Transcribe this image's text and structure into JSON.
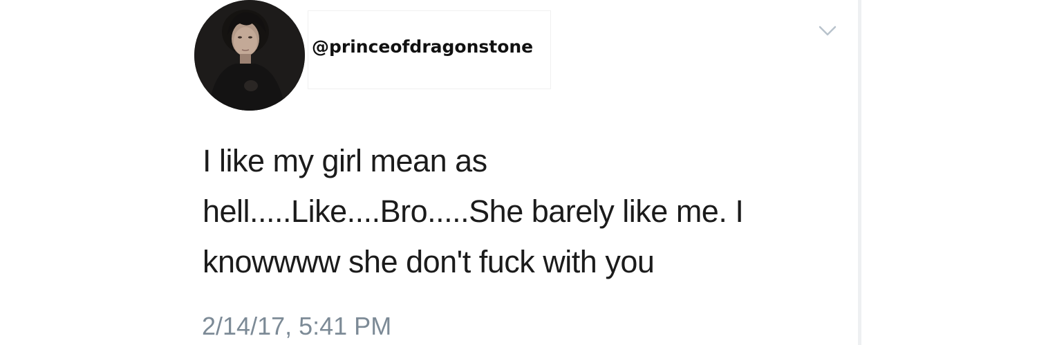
{
  "tweet": {
    "handle": "@princeofdragonstone",
    "text_lines": [
      "I like my girl mean as",
      "hell.....Like....Bro.....She barely like me. I",
      "knowwww she don't fuck with you"
    ],
    "timestamp": "2/14/17, 5:41 PM"
  },
  "icons": {
    "menu": "chevron-down-icon",
    "avatar": "profile-photo"
  },
  "colors": {
    "text": "#1b1b1b",
    "timestamp": "#7c8a96",
    "chevron": "#b8c2cc",
    "divider": "#eef0f2"
  }
}
